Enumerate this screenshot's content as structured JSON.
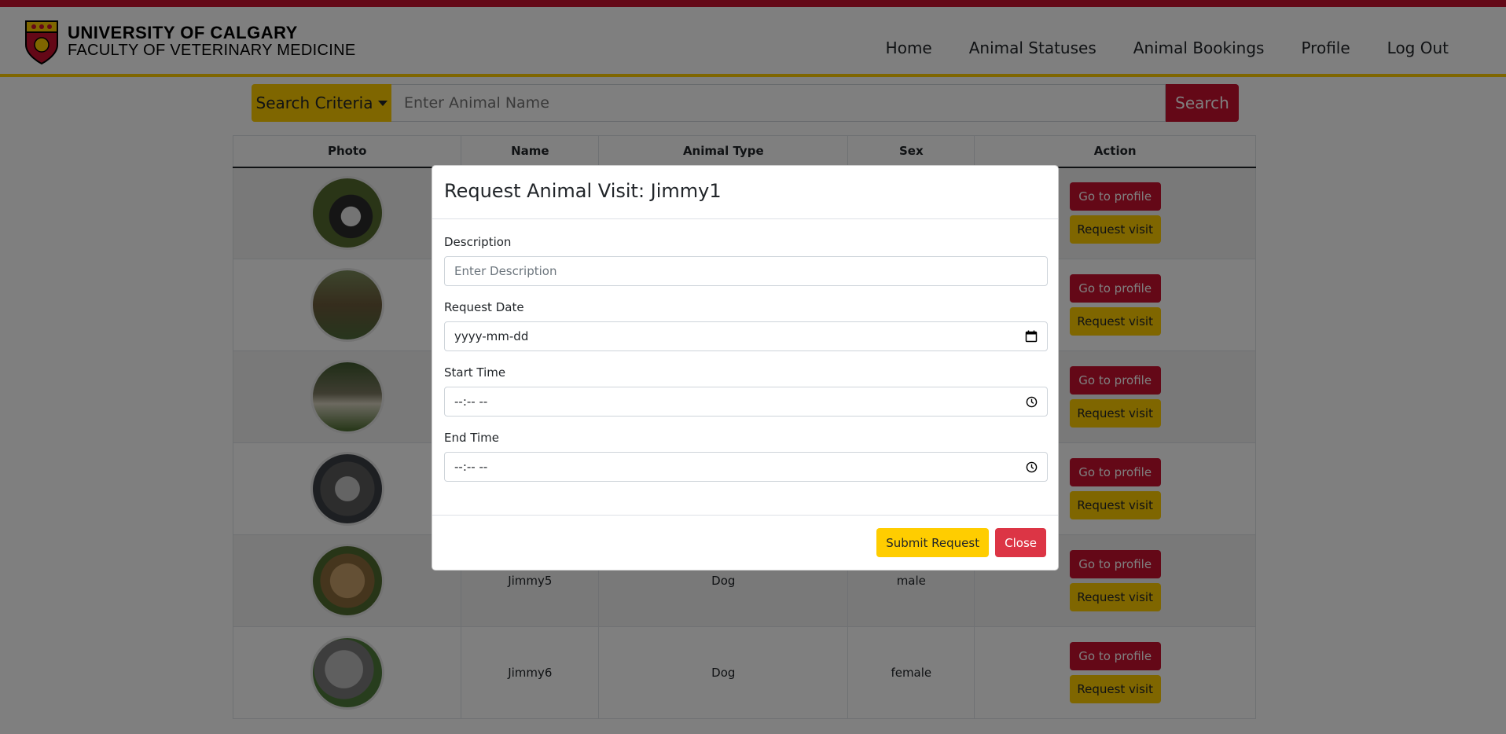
{
  "brand": {
    "line1": "UNIVERSITY OF CALGARY",
    "line2": "FACULTY OF VETERINARY MEDICINE"
  },
  "nav": {
    "items": [
      {
        "label": "Home"
      },
      {
        "label": "Animal Statuses"
      },
      {
        "label": "Animal Bookings"
      },
      {
        "label": "Profile"
      },
      {
        "label": "Log Out"
      }
    ]
  },
  "search": {
    "criteria_label": "Search Criteria",
    "placeholder": "Enter Animal Name",
    "button_label": "Search"
  },
  "table": {
    "headers": [
      "Photo",
      "Name",
      "Animal Type",
      "Sex",
      "Action"
    ],
    "rows": [
      {
        "name": "",
        "type": "",
        "sex": ""
      },
      {
        "name": "",
        "type": "",
        "sex": ""
      },
      {
        "name": "",
        "type": "",
        "sex": ""
      },
      {
        "name": "",
        "type": "",
        "sex": ""
      },
      {
        "name": "Jimmy5",
        "type": "Dog",
        "sex": "male"
      },
      {
        "name": "Jimmy6",
        "type": "Dog",
        "sex": "female"
      }
    ],
    "profile_label": "Go to profile",
    "visit_label": "Request visit"
  },
  "modal": {
    "title": "Request Animal Visit: Jimmy1",
    "description_label": "Description",
    "description_placeholder": "Enter Description",
    "date_label": "Request Date",
    "date_value": "yyyy-mm-dd",
    "start_label": "Start Time",
    "start_value": "--:-- --",
    "end_label": "End Time",
    "end_value": "--:-- --",
    "submit_label": "Submit Request",
    "close_label": "Close"
  },
  "colors": {
    "brand_red": "#c8102e",
    "brand_gold": "#ffcd00",
    "close_red": "#dc3545"
  }
}
